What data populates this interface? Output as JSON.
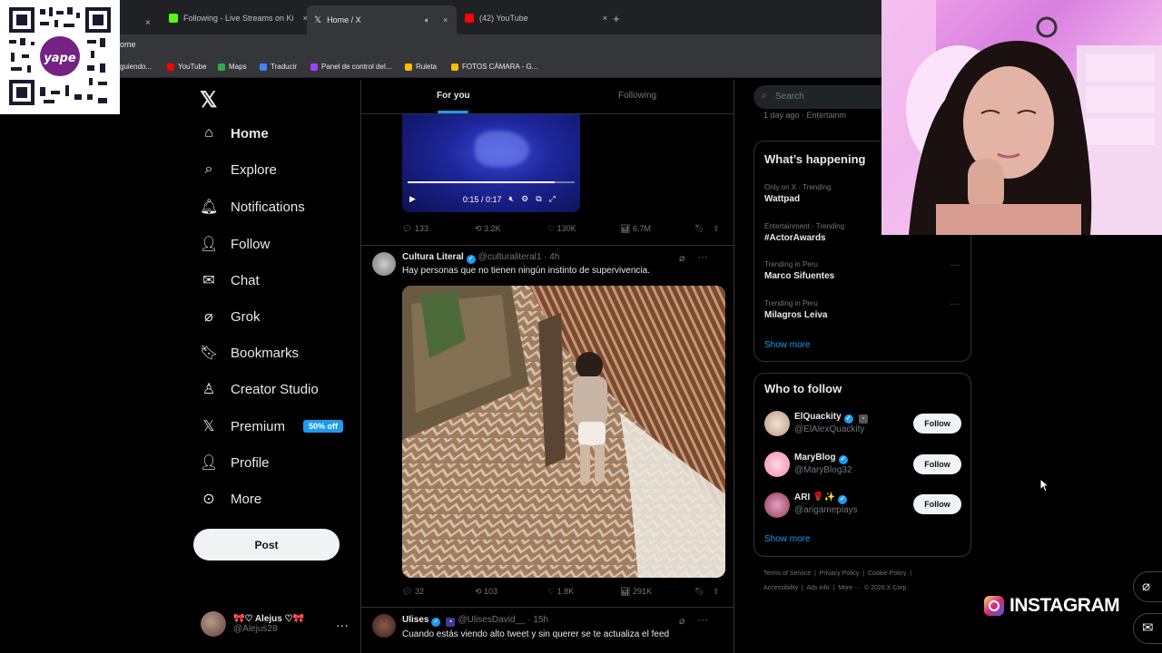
{
  "browser": {
    "tabs": [
      {
        "label": "Following - Live Streams on Ki",
        "icon": "kick-icon",
        "color": "#53fc18"
      },
      {
        "label": "Home / X",
        "icon": "x-icon",
        "active": true
      },
      {
        "label": "(42) YouTube",
        "icon": "youtube-icon",
        "color": "#ff0000"
      }
    ],
    "url": "ome",
    "bookmarks": [
      {
        "label": "guiendo..."
      },
      {
        "label": "YouTube",
        "color": "#ff0000"
      },
      {
        "label": "Maps",
        "color": "#34a853"
      },
      {
        "label": "Traducir",
        "color": "#4285f4"
      },
      {
        "label": "Panel de control del...",
        "color": "#a142f4"
      },
      {
        "label": "Ruleta",
        "color": "#fbbc04"
      },
      {
        "label": "FOTOS CÁMARA - G...",
        "color": "#fbbc04"
      }
    ]
  },
  "sidebar": {
    "logo": "𝕏",
    "items": [
      {
        "label": "Home",
        "icon": "home-icon",
        "bold": true
      },
      {
        "label": "Explore",
        "icon": "search-icon"
      },
      {
        "label": "Notifications",
        "icon": "bell-icon"
      },
      {
        "label": "Follow",
        "icon": "follow-icon"
      },
      {
        "label": "Chat",
        "icon": "mail-icon"
      },
      {
        "label": "Grok",
        "icon": "grok-icon"
      },
      {
        "label": "Bookmarks",
        "icon": "bookmark-icon"
      },
      {
        "label": "Creator Studio",
        "icon": "creator-icon"
      },
      {
        "label": "Premium",
        "icon": "x-icon",
        "badge": "50% off"
      },
      {
        "label": "Profile",
        "icon": "person-icon"
      },
      {
        "label": "More",
        "icon": "more-circle-icon"
      }
    ],
    "post_label": "Post",
    "account": {
      "name": "🎀♡ Alejus ♡🎀",
      "handle": "@Alejus28"
    }
  },
  "feed": {
    "tabs": [
      "For you",
      "Following"
    ],
    "video": {
      "time": "0:15 / 0:17",
      "progress": 0.88
    },
    "tweet0_stats": {
      "replies": "133",
      "reposts": "3.2K",
      "likes": "130K",
      "views": "6.7M"
    },
    "tweets": [
      {
        "name": "Cultura Literal",
        "handle": "@culturaliteral1",
        "time": "· 4h",
        "text": "Hay personas que no tienen ningún instinto de supervivencia.",
        "stats": {
          "replies": "32",
          "reposts": "103",
          "likes": "1.8K",
          "views": "291K"
        }
      },
      {
        "name": "Ulises",
        "handle": "@UlisesDavid__",
        "time": "· 15h",
        "text": "Cuando estás viendo alto tweet y sin querer se te actualiza el feed"
      }
    ]
  },
  "right": {
    "search_placeholder": "Search",
    "recent_meta": "1 day ago · Entertainm",
    "happening": {
      "title": "What’s happening",
      "trends": [
        {
          "meta": "Only on X · Trending",
          "name": "Wattpad"
        },
        {
          "meta": "Entertainment · Trending",
          "name": "#ActorAwards"
        },
        {
          "meta": "Trending in Peru",
          "name": "Marco Sifuentes"
        },
        {
          "meta": "Trending in Peru",
          "name": "Milagros Leiva"
        }
      ],
      "show_more": "Show more"
    },
    "who_to_follow": {
      "title": "Who to follow",
      "users": [
        {
          "name": "ElQuackity",
          "handle": "@ElAlexQuackity",
          "button": "Follow"
        },
        {
          "name": "MaryBlog",
          "handle": "@MaryBlog32",
          "button": "Follow"
        },
        {
          "name": "ARI 🌹✨",
          "handle": "@arigameplays",
          "button": "Follow"
        }
      ],
      "show_more": "Show more"
    },
    "footer": {
      "line1": [
        "Terms of Service",
        "Privacy Policy",
        "Cookie Policy"
      ],
      "line2": [
        "Accessibility",
        "Ads info",
        "More ···",
        "© 2026 X Corp."
      ]
    }
  },
  "overlay": {
    "instagram": "INSTAGRAM",
    "qr_brand": "yape"
  }
}
